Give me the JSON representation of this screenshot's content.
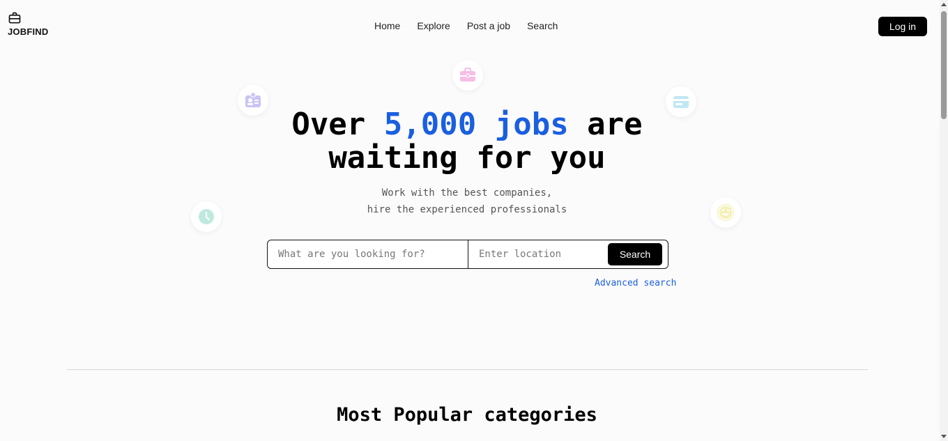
{
  "brand": {
    "name": "JOBFIND",
    "icon": "briefcase-icon"
  },
  "nav": {
    "items": [
      "Home",
      "Explore",
      "Post a job",
      "Search"
    ]
  },
  "header": {
    "login_label": "Log in"
  },
  "hero": {
    "title_prefix": "Over ",
    "title_accent": "5,000 jobs",
    "title_suffix": " are",
    "title_line2": "waiting for you",
    "subtitle_line1": "Work with the best companies,",
    "subtitle_line2": "hire the experienced professionals",
    "accent_color": "#1a5fe0"
  },
  "search": {
    "what_placeholder": "What are you looking for?",
    "location_placeholder": "Enter location",
    "button_label": "Search",
    "advanced_label": "Advanced search"
  },
  "decor_icons": [
    "id-card-icon",
    "briefcase-icon",
    "credit-card-icon",
    "clock-icon",
    "smiley-icon"
  ],
  "categories": {
    "title": "Most Popular categories"
  }
}
